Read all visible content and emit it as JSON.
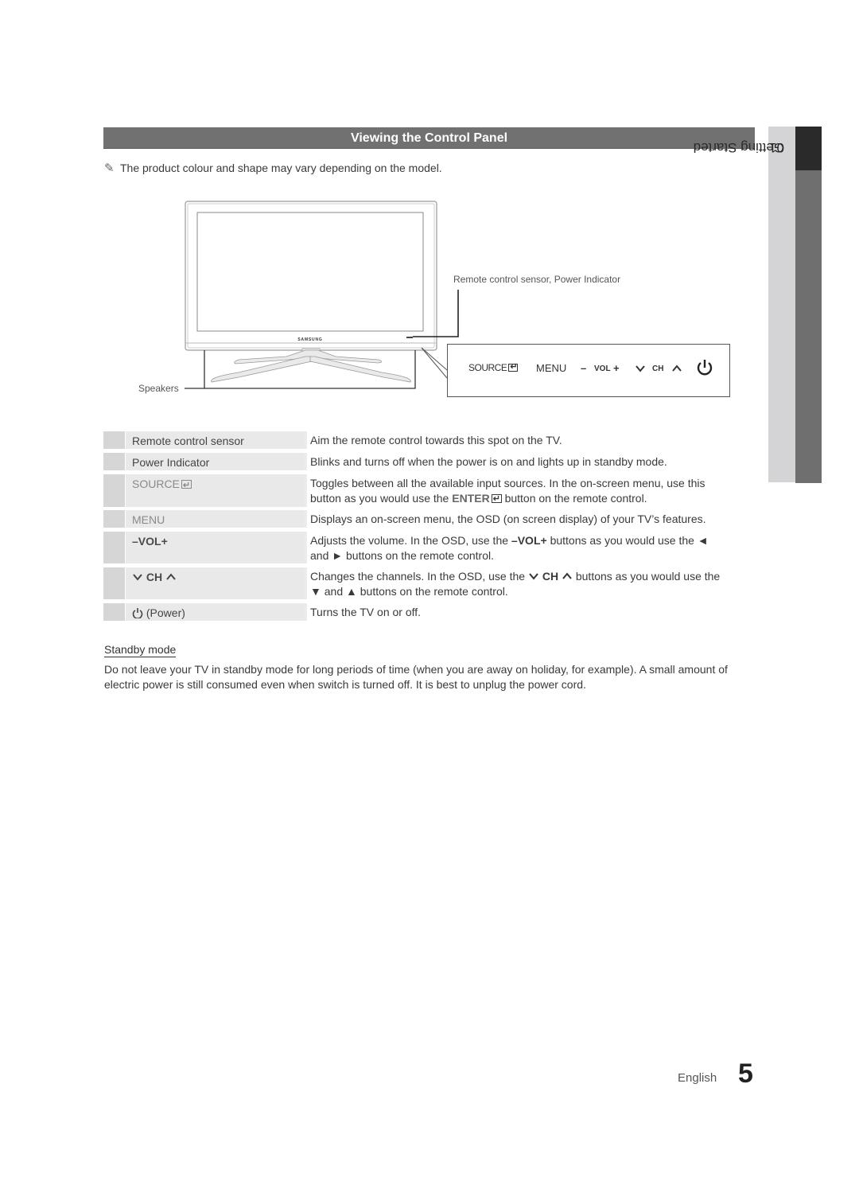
{
  "section": {
    "title": "Viewing the Control Panel",
    "note": "The product colour and shape may vary depending on the model.",
    "note_icon": "pencil-icon"
  },
  "side_tab": {
    "chapter_number": "01",
    "chapter_title": "Getting Started"
  },
  "diagram": {
    "brand_logo": "SAMSUNG",
    "callout_sensor": "Remote control sensor, Power Indicator",
    "callout_speakers": "Speakers",
    "control_strip": {
      "source": "SOURCE",
      "menu": "MENU",
      "vol_minus": "–",
      "vol": "VOL",
      "vol_plus": "+",
      "ch": "CH",
      "icons": [
        "enter-icon",
        "chevron-down-icon",
        "chevron-up-icon",
        "power-icon"
      ]
    }
  },
  "table": {
    "rows": [
      {
        "key": "Remote control sensor",
        "desc": "Aim the remote control towards this spot on the TV."
      },
      {
        "key": "Power Indicator",
        "desc": "Blinks and turns off when the power is on and lights up in standby mode."
      },
      {
        "key": "SOURCE",
        "desc_line1": "Toggles between all the available input sources. In the on-screen menu, use this",
        "desc_line2_pre": "button as you would use the ",
        "desc_enter": "ENTER",
        "desc_line2_post": " button on the remote control."
      },
      {
        "key": "MENU",
        "desc": "Displays an on-screen menu, the OSD (on screen display) of your TV’s features."
      },
      {
        "key_minus": "–",
        "key": "VOL",
        "key_plus": "+",
        "desc_pre": "Adjusts the volume. In the OSD, use the ",
        "desc_vol": "VOL",
        "desc_post": " buttons as you would use the ◄",
        "desc_line2": "and ► buttons on the remote control."
      },
      {
        "key": "CH",
        "desc_pre": "Changes the channels. In the OSD, use the ",
        "desc_ch": "CH",
        "desc_post": " buttons as you would use the",
        "desc_line2": "▼ and ▲ buttons on the remote control."
      },
      {
        "key": "(Power)",
        "desc": "Turns the TV on or off."
      }
    ]
  },
  "standby": {
    "title": "Standby mode",
    "body": "Do not leave your TV in standby mode for long periods of time (when you are away on holiday, for example). A small amount of electric power is still consumed even when switch is turned off. It is best to unplug the power cord."
  },
  "footer": {
    "language": "English",
    "page_number": "5"
  }
}
